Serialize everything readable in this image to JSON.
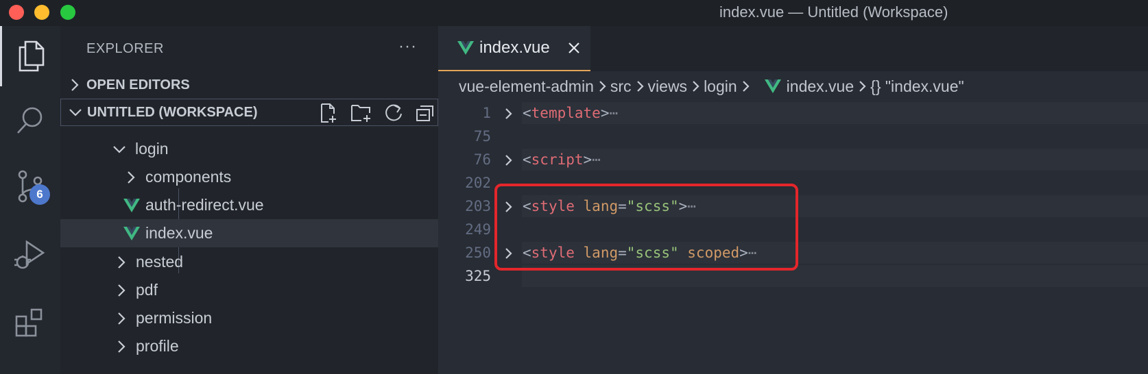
{
  "window": {
    "title": "index.vue — Untitled (Workspace)"
  },
  "activity_bar": {
    "items": [
      {
        "name": "explorer",
        "icon": "files-icon",
        "active": true
      },
      {
        "name": "search",
        "icon": "search-icon"
      },
      {
        "name": "source-control",
        "icon": "source-control-icon",
        "badge": "6"
      },
      {
        "name": "run-and-debug",
        "icon": "run-debug-icon"
      },
      {
        "name": "extensions",
        "icon": "extensions-icon"
      }
    ]
  },
  "sidebar": {
    "title": "EXPLORER",
    "more": "···",
    "open_editors": "OPEN EDITORS",
    "workspace": "UNTITLED (WORKSPACE)",
    "workspace_tools": [
      "new-file-icon",
      "new-folder-icon",
      "refresh-icon",
      "collapse-all-icon"
    ],
    "tree": [
      {
        "label": "login",
        "type": "folder",
        "expanded": true
      },
      {
        "label": "components",
        "type": "folder",
        "expanded": false
      },
      {
        "label": "auth-redirect.vue",
        "type": "vue-file"
      },
      {
        "label": "index.vue",
        "type": "vue-file",
        "selected": true
      },
      {
        "label": "nested",
        "type": "folder",
        "expanded": false
      },
      {
        "label": "pdf",
        "type": "folder",
        "expanded": false
      },
      {
        "label": "permission",
        "type": "folder",
        "expanded": false
      },
      {
        "label": "profile",
        "type": "folder",
        "expanded": false
      }
    ]
  },
  "editor": {
    "tab": {
      "label": "index.vue",
      "close": "close-icon"
    },
    "breadcrumb": [
      "vue-element-admin",
      "src",
      "views",
      "login",
      "index.vue",
      "{} \"index.vue\""
    ],
    "lines": [
      {
        "num": "1",
        "folded": true,
        "parts": {
          "open": "<",
          "tag": "template",
          "close": ">",
          "ellipsis": "⋯"
        }
      },
      {
        "num": "75"
      },
      {
        "num": "76",
        "folded": true,
        "parts": {
          "open": "<",
          "tag": "script",
          "close": ">",
          "ellipsis": "⋯"
        }
      },
      {
        "num": "202"
      },
      {
        "num": "203",
        "folded": true,
        "parts": {
          "open": "<",
          "tag": "style",
          "attr": "lang",
          "eq": "=",
          "str": "\"scss\"",
          "close": ">",
          "ellipsis": "⋯"
        }
      },
      {
        "num": "249"
      },
      {
        "num": "250",
        "folded": true,
        "parts": {
          "open": "<",
          "tag": "style",
          "attr": "lang",
          "eq": "=",
          "str": "\"scss\"",
          "attr2": "scoped",
          "close": ">",
          "ellipsis": "⋯"
        }
      },
      {
        "num": "325",
        "current": true
      }
    ]
  },
  "colors": {
    "accent_tab_underline": "#e5a45a",
    "highlight_box": "#e3262b",
    "badge": "#4d78cc",
    "vue_green": "#41b883",
    "vue_dark": "#35495e"
  }
}
